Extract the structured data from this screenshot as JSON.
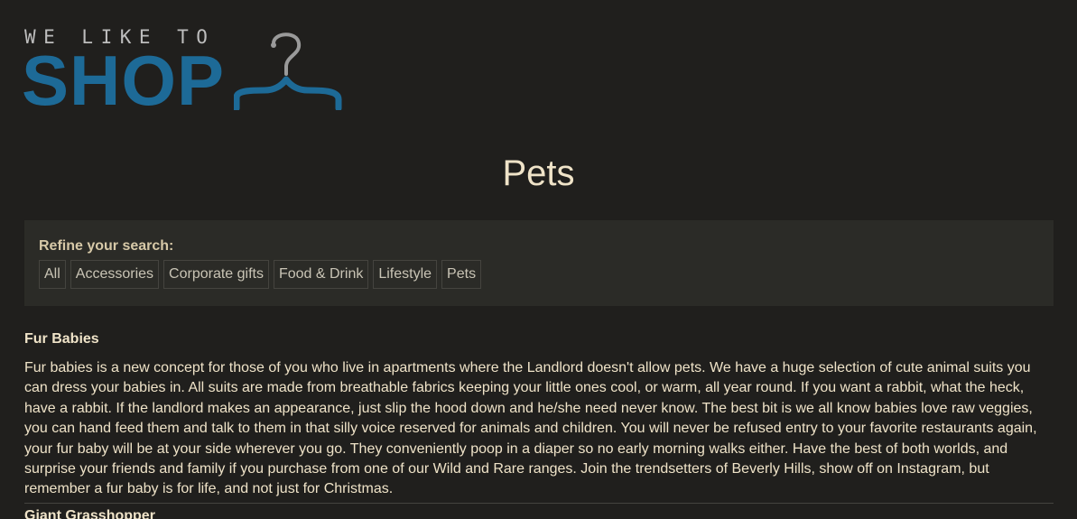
{
  "logo": {
    "tagline": "WE LIKE TO",
    "wordmark": "SHOP",
    "icon": "hanger-icon",
    "colors": {
      "tagline": "#bdbdbd",
      "wordmark": "#1d6a97"
    }
  },
  "page": {
    "title": "Pets"
  },
  "filters": {
    "label": "Refine your search:",
    "items": [
      {
        "label": "All"
      },
      {
        "label": "Accessories"
      },
      {
        "label": "Corporate gifts"
      },
      {
        "label": "Food & Drink"
      },
      {
        "label": "Lifestyle"
      },
      {
        "label": "Pets"
      }
    ]
  },
  "products": [
    {
      "name": "Fur Babies",
      "description": "Fur babies is a new concept for those of you who live in apartments where the Landlord doesn't allow pets. We have a huge selection of cute animal suits you can dress your babies in. All suits are made from breathable fabrics keeping your little ones cool, or warm, all year round. If you want a rabbit, what the heck, have a rabbit. If the landlord makes an appearance, just slip the hood down and he/she need never know. The best bit is we all know babies love raw veggies, you can hand feed them and talk to them in that silly voice reserved for animals and children. You will never be refused entry to your favorite restaurants again, your fur baby will be at your side wherever you go. They conveniently poop in a diaper so no early morning walks either. Have the best of both worlds, and surprise your friends and family if you purchase from one of our Wild and Rare ranges. Join the trendsetters of Beverly Hills, show off on Instagram, but remember a fur baby is for life, and not just for Christmas."
    },
    {
      "name": "Giant Grasshopper"
    }
  ],
  "colors": {
    "background": "#201f1d",
    "text": "#efe3c8",
    "panel": "#2b2b27",
    "border": "#45443f"
  }
}
